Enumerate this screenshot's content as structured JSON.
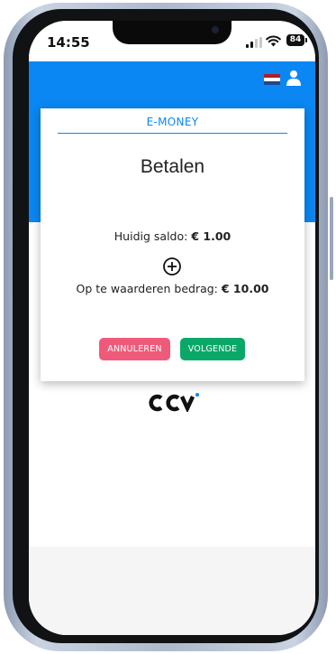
{
  "status_bar": {
    "time": "14:55",
    "battery": "84"
  },
  "header": {
    "language_flag": "netherlands-flag",
    "user_icon": "user-icon",
    "bar_color": "#0a87f2"
  },
  "card": {
    "section_label": "E-MONEY",
    "title": "Betalen",
    "balance_label": "Huidig saldo:",
    "balance_value": "€ 1.00",
    "add_icon": "plus-circle-icon",
    "amount_label": "Op te waarderen bedrag:",
    "amount_value": "€ 10.00",
    "cancel_button": "ANNULEREN",
    "next_button": "VOLGENDE"
  },
  "colors": {
    "cancel": "#f05a7a",
    "next": "#0aa868",
    "accent": "#0a87f2"
  },
  "logo": "ccv-logo"
}
